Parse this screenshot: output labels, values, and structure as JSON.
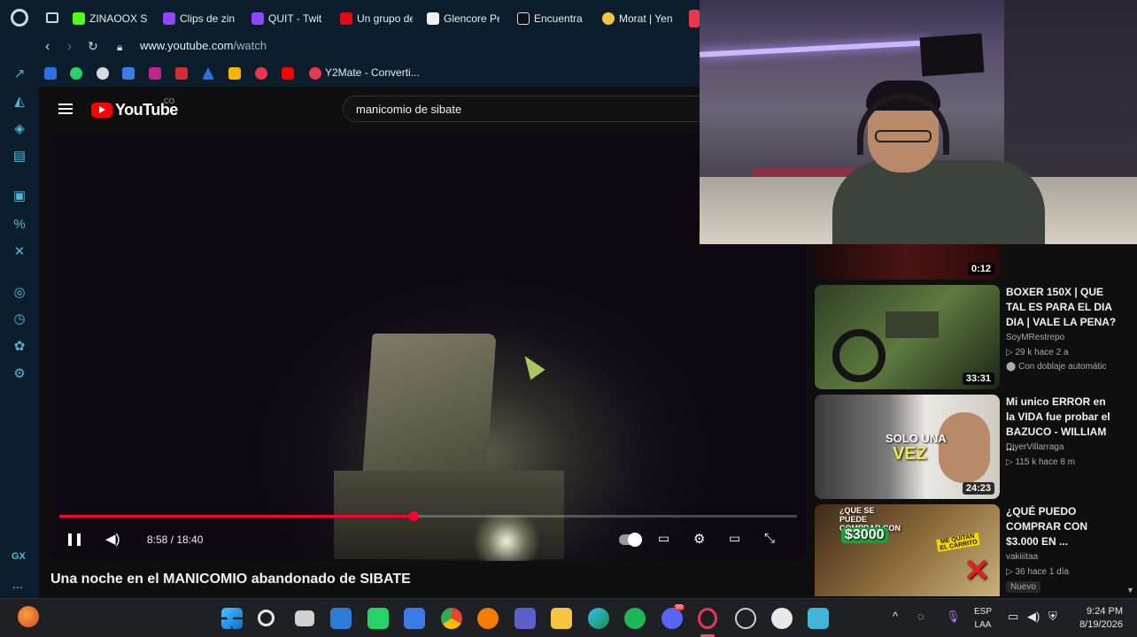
{
  "browser": {
    "tabs": [
      {
        "label": "ZINAOOX St",
        "favicon_color": "#53fc18"
      },
      {
        "label": "Clips de zin",
        "favicon_color": "#9146ff"
      },
      {
        "label": "QUIT - Twit",
        "favicon_color": "#9146ff"
      },
      {
        "label": "Un grupo de",
        "favicon_color": "#e50914"
      },
      {
        "label": "Glencore Pe",
        "favicon_color": "#f1f1f1"
      },
      {
        "label": "Encuentra",
        "favicon_color": "#111111"
      },
      {
        "label": "Morat | Yen",
        "favicon_color": "#f5c542"
      }
    ],
    "url_host": "www.youtube.com",
    "url_path": "/watch",
    "bookmarks": [
      {
        "label": "Y2Mate - Converti...",
        "favicon_color": "#e8384f"
      }
    ],
    "sidebar_bottom_label": "GX",
    "sidebar_more": "..."
  },
  "youtube": {
    "logo_text": "YouTube",
    "country_code": "CO",
    "search_query": "manicomio de sibate",
    "player": {
      "time_current": "8:58",
      "time_total": "18:40",
      "time_display": "8:58 / 18:40",
      "progress": 0.48
    },
    "video_title": "Una noche en el MANICOMIO abandonado de SIBATE",
    "recommendations": [
      {
        "duration": "0:12",
        "partial": true
      },
      {
        "title": "BOXER 150X | QUE TAL ES PARA EL DIA DIA | VALE LA PENA?",
        "channel": "SoyMRestrepo",
        "meta": "▷ 29 k  hace 2 a",
        "badge": "Con doblaje automátic",
        "duration": "33:31"
      },
      {
        "title": "Mi unico ERROR en la VIDA fue probar el BAZUCO - WILLIAM ...",
        "channel": "DiyerVillarraga",
        "meta": "▷ 115 k  hace 8 m",
        "duration": "24:23",
        "thumb_text_line1": "SOLO UNA",
        "thumb_text_line2": "VEZ"
      },
      {
        "title": "¿QUÉ PUEDO COMPRAR CON $3.000 EN ...",
        "channel": "vakiiitaa",
        "meta": "▷ 36  hace 1 día",
        "badge": "Nuevo",
        "thumb_text_line1": "¿QUE SE PUEDE COMPRAR CON",
        "thumb_text_line2": "$3000",
        "thumb_text_3": "ME QUITAN EL CARRITO"
      }
    ]
  },
  "taskbar": {
    "lang_line1": "ESP",
    "lang_line2": "LAA",
    "time": "9:24 PM",
    "date": "8/19/2026",
    "discord_badge": "99"
  }
}
